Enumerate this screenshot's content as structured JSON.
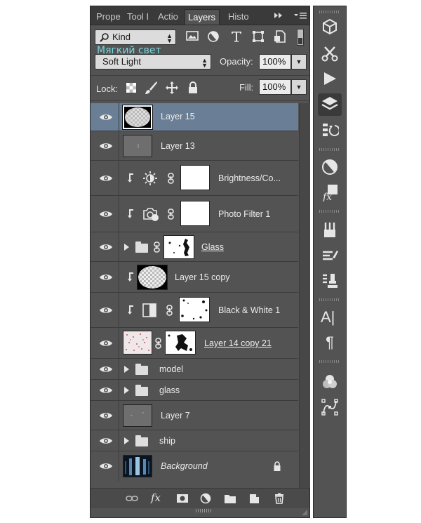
{
  "tabs": [
    "Prope",
    "Tool I",
    "Actio",
    "Layers",
    "Histo"
  ],
  "filter_kind": "Kind",
  "overlay_text": "Мягкий свет",
  "blend_mode": "Soft Light",
  "opacity_label": "Opacity:",
  "opacity_value": "100%",
  "lock_label": "Lock:",
  "fill_label": "Fill:",
  "fill_value": "100%",
  "layers": [
    {
      "name": "Layer 15"
    },
    {
      "name": "Layer 13"
    },
    {
      "name": "Brightness/Co..."
    },
    {
      "name": "Photo Filter 1"
    },
    {
      "name": "Glass"
    },
    {
      "name": "Layer 15 copy"
    },
    {
      "name": "Black & White 1"
    },
    {
      "name": "Layer 14 copy 21"
    },
    {
      "name": "model"
    },
    {
      "name": "glass"
    },
    {
      "name": "Layer 7"
    },
    {
      "name": "ship"
    },
    {
      "name": "Background"
    }
  ],
  "bottom_icons": [
    "link-icon",
    "fx-icon",
    "mask-icon",
    "adjustment-icon",
    "folder-icon",
    "new-layer-icon",
    "trash-icon"
  ],
  "fx_label": "fx",
  "toolstrip_icons": [
    "3d-cube-icon",
    "scissors-tools-icon",
    "play-icon",
    "layers-icon",
    "history-brush-icon",
    "adjustments-circle-icon",
    "styles-fx-icon",
    "brushes-icon",
    "brush-presets-icon",
    "clone-source-icon",
    "character-icon",
    "paragraph-icon",
    "channels-icon",
    "paths-icon"
  ],
  "char_label": "A|",
  "para_label": "¶",
  "styles_label": "fx"
}
